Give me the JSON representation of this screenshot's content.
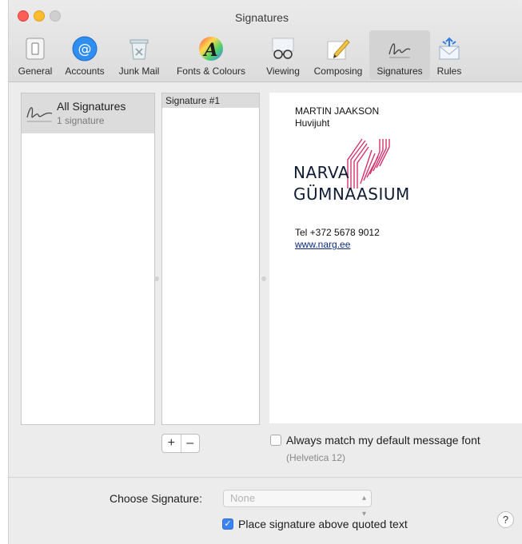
{
  "window": {
    "title": "Signatures"
  },
  "toolbar": {
    "items": [
      {
        "label": "General",
        "icon": "general-switch-icon"
      },
      {
        "label": "Accounts",
        "icon": "at-sign-icon"
      },
      {
        "label": "Junk Mail",
        "icon": "trash-junk-icon"
      },
      {
        "label": "Fonts & Colours",
        "icon": "color-wheel-font-icon"
      },
      {
        "label": "Viewing",
        "icon": "glasses-icon"
      },
      {
        "label": "Composing",
        "icon": "pencil-icon"
      },
      {
        "label": "Signatures",
        "icon": "signature-icon",
        "selected": true
      },
      {
        "label": "Rules",
        "icon": "envelope-rules-icon"
      }
    ]
  },
  "accounts_list": {
    "all_label": "All Signatures",
    "count_label": "1 signature"
  },
  "signatures_list": {
    "items": [
      "Signature #1"
    ]
  },
  "preview": {
    "name": "MARTIN JAAKSON",
    "role": "Huvijuht",
    "logo_line1": "NARVA",
    "logo_line2": "GÜMNAASIUM",
    "tel": "Tel +372 5678 9012",
    "website": "www.narg.ee",
    "brand_color": "#d6336c"
  },
  "controls": {
    "add": "+",
    "remove": "–",
    "match_font_label": "Always match my default message font",
    "match_font_checked": false,
    "font_hint": "(Helvetica 12)",
    "choose_label": "Choose Signature:",
    "choose_value": "None",
    "place_above_label": "Place signature above quoted text",
    "place_above_checked": true,
    "help": "?"
  }
}
